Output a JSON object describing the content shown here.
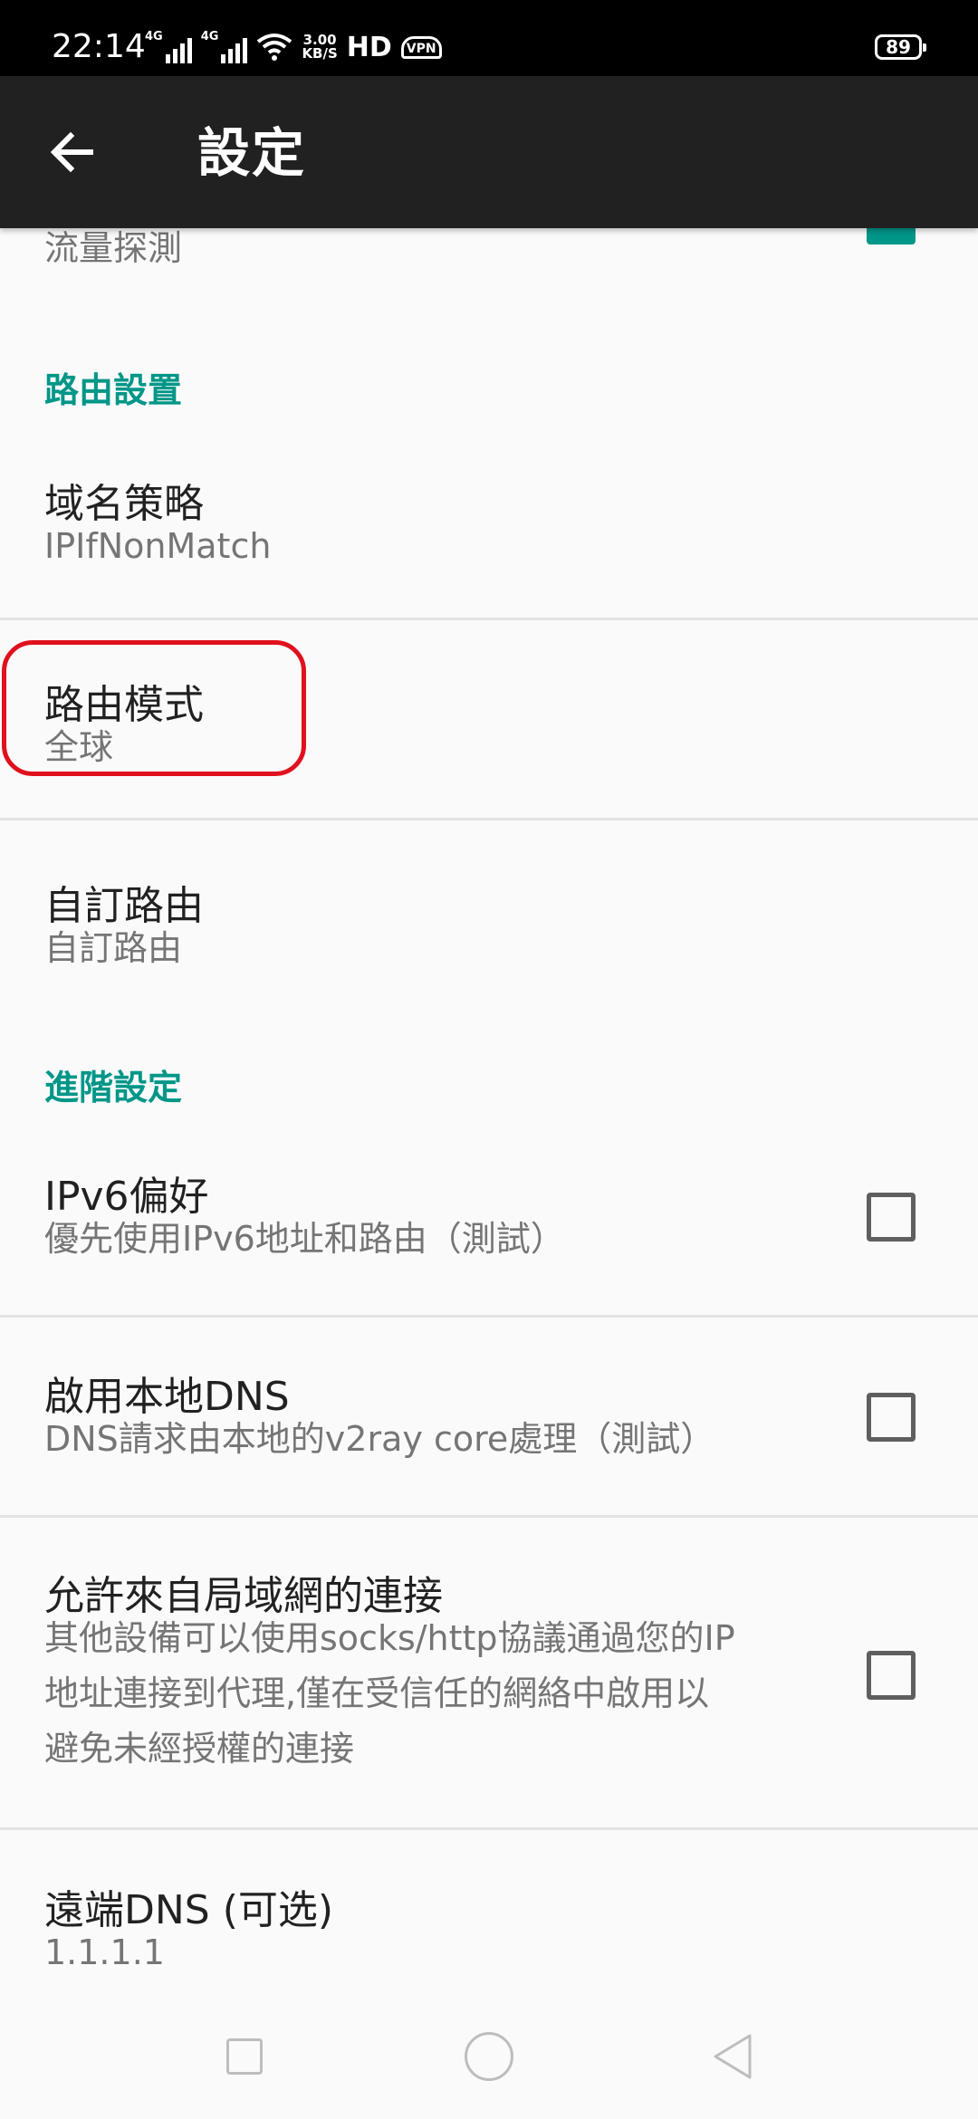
{
  "status_bar": {
    "time": "22:14",
    "net1": "4G",
    "net2": "4G",
    "speed_value": "3.00",
    "speed_unit": "KB/S",
    "hd": "HD",
    "vpn": "VPN",
    "battery": "89",
    "icons": [
      "signal-icon",
      "wifi-icon",
      "vpn-icon",
      "battery-icon"
    ]
  },
  "app_bar": {
    "title": "設定",
    "back_icon": "arrow-back-icon"
  },
  "partial_item": {
    "summary": "流量探測",
    "checked": true
  },
  "sections": {
    "routing": {
      "header": "路由設置",
      "items": [
        {
          "title": "域名策略",
          "summary": "IPIfNonMatch"
        },
        {
          "title": "路由模式",
          "summary": "全球"
        },
        {
          "title": "自訂路由",
          "summary": "自訂路由"
        }
      ]
    },
    "advanced": {
      "header": "進階設定",
      "items": [
        {
          "title": "IPv6偏好",
          "summary": "優先使用IPv6地址和路由（測試）",
          "checked": false
        },
        {
          "title": "啟用本地DNS",
          "summary": "DNS請求由本地的v2ray core處理（測試）",
          "checked": false
        },
        {
          "title": "允許來自局域網的連接",
          "summary_lines": [
            "其他設備可以使用socks/http協議通過您的IP",
            "地址連接到代理,僅在受信任的網絡中啟用以",
            "避免未經授權的連接"
          ],
          "checked": false
        },
        {
          "title": "遠端DNS (可选)",
          "summary": "1.1.1.1"
        }
      ]
    }
  },
  "colors": {
    "accent": "#009688",
    "app_bar": "#212121",
    "highlight": "#e0101d",
    "background": "#fafafa"
  },
  "nav_bar": {
    "icons": [
      "recents-icon",
      "home-icon",
      "back-icon"
    ]
  }
}
